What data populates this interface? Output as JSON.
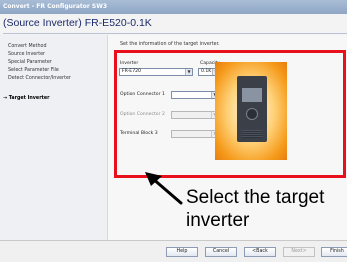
{
  "window": {
    "title": "Convert - FR Configurator SW3",
    "page_title": "(Source Inverter) FR-E520-0.1K"
  },
  "sidebar": {
    "items": [
      {
        "label": "Convert Method"
      },
      {
        "label": "Source Inverter"
      },
      {
        "label": "Special Parameter"
      },
      {
        "label": "Select Parameter File"
      },
      {
        "label": "Detect Connector/Inverter"
      },
      {
        "label": "Target Inverter",
        "active": true
      }
    ]
  },
  "main": {
    "instruction": "Set the information of the target inverter.",
    "inverter": {
      "label": "Inverter",
      "value": "FR-E720"
    },
    "capacity": {
      "label": "Capacity",
      "value": "0.1K"
    },
    "option_connector_1": {
      "label": "Option Connector 1",
      "value": ""
    },
    "option_connector_2": {
      "label": "Option Connector 2",
      "value": ""
    },
    "terminal_block_3": {
      "label": "Terminal Block 3",
      "value": ""
    }
  },
  "callout": {
    "line1": "Select the target",
    "line2": "inverter",
    "color": "#e8101b"
  },
  "footer": {
    "buttons": [
      {
        "label": "Help"
      },
      {
        "label": "Cancel"
      },
      {
        "label": "<Back"
      },
      {
        "label": "Next>"
      },
      {
        "label": "Finish"
      }
    ]
  }
}
